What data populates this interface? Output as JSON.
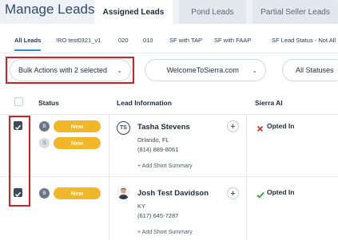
{
  "header": {
    "title": "Manage Leads",
    "tabs": [
      {
        "label": "Assigned Leads",
        "active": true
      },
      {
        "label": "Pond Leads",
        "active": false
      },
      {
        "label": "Partial Seller Leads",
        "active": false
      }
    ]
  },
  "filter_chips": [
    "All Leads",
    "!RO test0321_v1",
    "020",
    "010",
    "SF with TAP",
    "SF with FAAP",
    "SF Lead Status - Not All"
  ],
  "toolbar": {
    "bulk_actions": "Bulk Actions with 2 selected",
    "campaign": "WelcomeToSierra.com",
    "status_filter": "All Statuses"
  },
  "columns": {
    "status": "Status",
    "lead_info": "Lead Information",
    "sierra_ai": "Sierra AI"
  },
  "colors": {
    "accent_blue": "#2d8ee3",
    "pill_yellow": "#f2b629",
    "red_box": "#d42020",
    "check_green": "#2e9e4a",
    "x_red": "#d23a2a"
  },
  "rows": [
    {
      "checked": true,
      "badges": [
        {
          "letter": "B",
          "status": "New"
        },
        {
          "letter": "S",
          "status": "New"
        }
      ],
      "avatar_initials": "TS",
      "name": "Tasha Stevens",
      "location": "Orlando, FL",
      "phone": "(814) 889-8061",
      "add_summary": "+ Add Short Summary",
      "sierra_ai": "Opted In",
      "sierra_ai_icon": "x-icon"
    },
    {
      "checked": true,
      "badges": [
        {
          "letter": "B",
          "status": "New"
        }
      ],
      "avatar_initials": "",
      "name": "Josh Test Davidson",
      "location": "KY",
      "phone": "(617) 645-7287",
      "add_summary": "+ Add Short Summary",
      "sierra_ai": "Opted In",
      "sierra_ai_icon": "check-icon"
    }
  ]
}
